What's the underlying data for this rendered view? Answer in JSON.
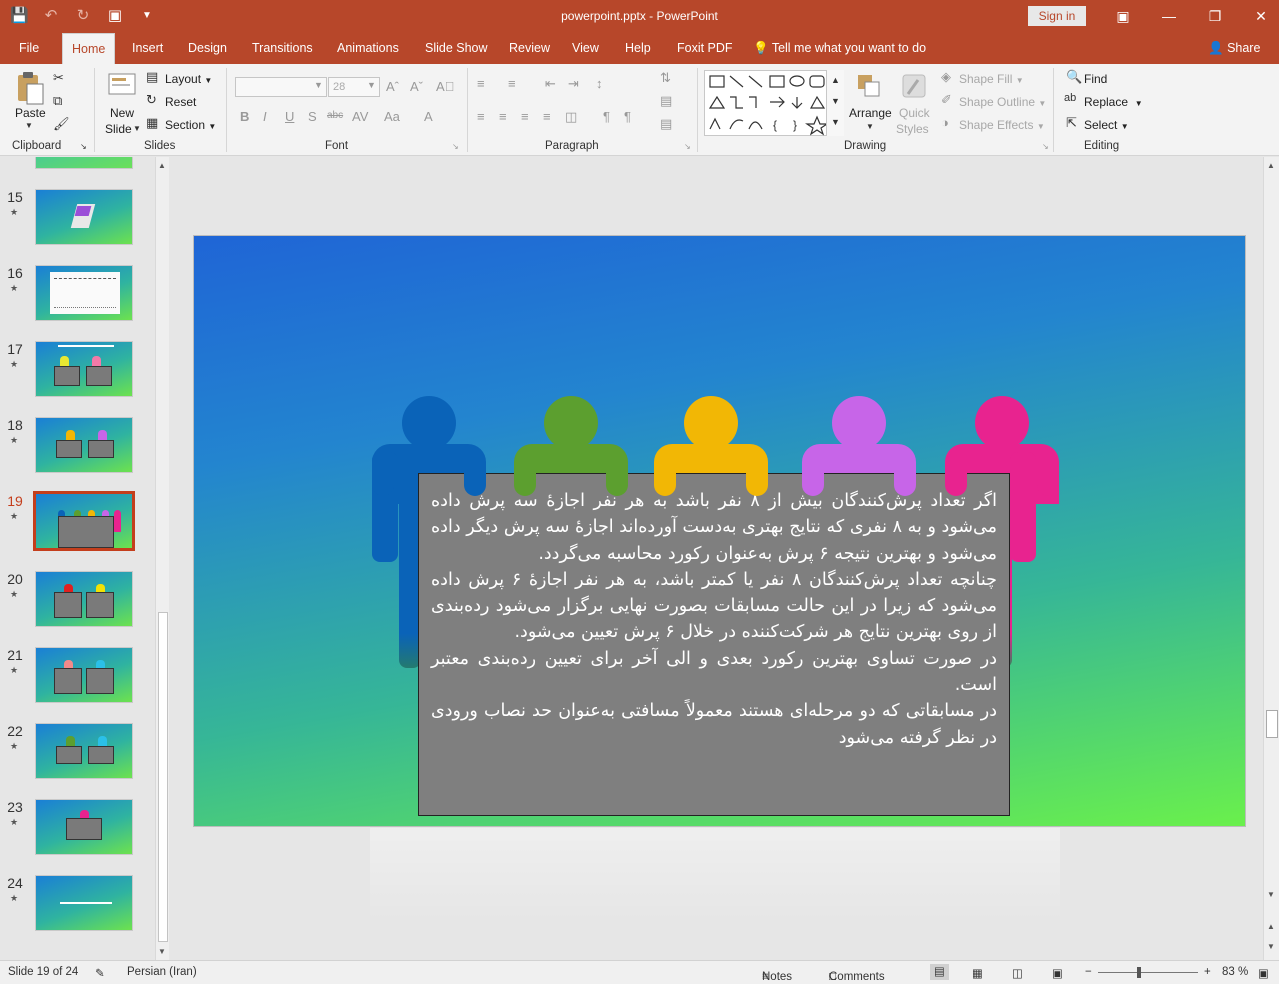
{
  "titlebar": {
    "title": "powerpoint.pptx  -  PowerPoint",
    "signin": "Sign in"
  },
  "tabs": [
    "File",
    "Home",
    "Insert",
    "Design",
    "Transitions",
    "Animations",
    "Slide Show",
    "Review",
    "View",
    "Help",
    "Foxit PDF"
  ],
  "tell_me": "Tell me what you want to do",
  "share": "Share",
  "ribbon": {
    "clipboard": {
      "paste": "Paste",
      "label": "Clipboard"
    },
    "slides": {
      "new_slide_1": "New",
      "new_slide_2": "Slide",
      "layout": "Layout",
      "reset": "Reset",
      "section": "Section",
      "label": "Slides"
    },
    "font": {
      "size": "28",
      "label": "Font"
    },
    "paragraph": {
      "label": "Paragraph"
    },
    "drawing": {
      "arrange": "Arrange",
      "quick_styles_1": "Quick",
      "quick_styles_2": "Styles",
      "shape_fill": "Shape Fill",
      "shape_outline": "Shape Outline",
      "shape_effects": "Shape Effects",
      "label": "Drawing"
    },
    "editing": {
      "find": "Find",
      "replace": "Replace",
      "select": "Select",
      "label": "Editing"
    }
  },
  "thumbnails": [
    {
      "num": "15"
    },
    {
      "num": "16"
    },
    {
      "num": "17"
    },
    {
      "num": "18"
    },
    {
      "num": "19"
    },
    {
      "num": "20"
    },
    {
      "num": "21"
    },
    {
      "num": "22"
    },
    {
      "num": "23"
    },
    {
      "num": "24"
    }
  ],
  "slide": {
    "paragraphs": [
      "اگر تعداد پرش‌کنندگان بیش از ۸ نفر باشد به هر نفر اجازهٔ سه پرش داده می‌شود و به ۸ نفری که نتایج بهتری به‌دست آورده‌اند اجازهٔ سه پرش دیگر داده می‌شود و بهترین نتیجه ۶ پرش به‌عنوان رکورد محاسبه می‌گردد.",
      "چنانچه تعداد پرش‌کنندگان ۸ نفر یا کمتر باشد، به هر نفر اجازهٔ ۶ پرش داده می‌شود که زیرا در این حالت مسابقات بصورت نهایی برگزار می‌شود رده‌بندی از روی بهترین نتایج هر شرکت‌کننده در خلال ۶ پرش تعیین می‌شود.",
      "در صورت تساوی بهترین رکورد بعدی و الی آخر برای تعیین رده‌بندی معتبر است.",
      "در مسابقاتی که دو مرحله‌ای هستند معمولاً مسافتی به‌عنوان حد نصاب ورودی در نظر گرفته می‌شود"
    ],
    "figure_colors": [
      "#0a63b8",
      "#5c9f2f",
      "#f2b705",
      "#c765e8",
      "#e8238f"
    ]
  },
  "status": {
    "slide_of": "Slide 19 of 24",
    "language": "Persian (Iran)",
    "notes": "Notes",
    "comments": "Comments",
    "zoom": "83 %"
  }
}
